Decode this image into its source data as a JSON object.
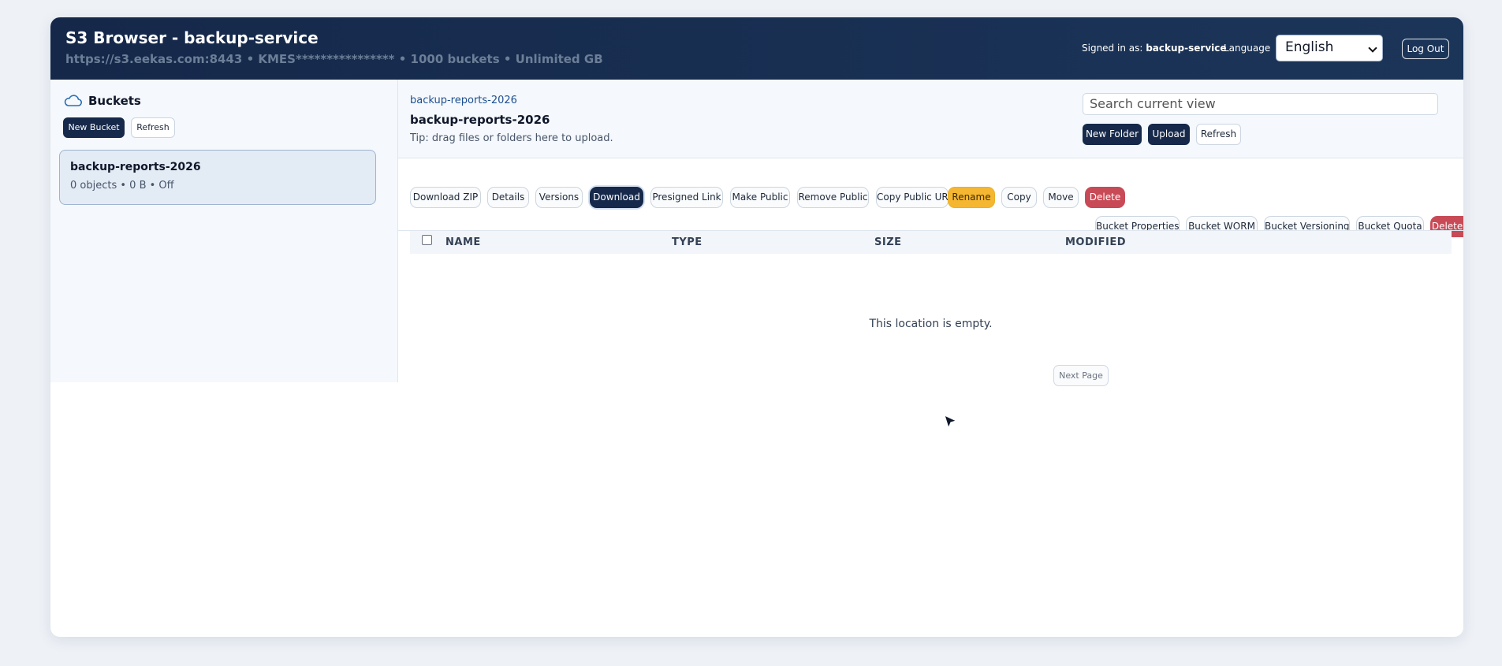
{
  "header": {
    "title": "S3 Browser - backup-service",
    "subtitle": "https://s3.eekas.com:8443 • KMES**************** • 1000 buckets • Unlimited GB",
    "signed_in_label": "Signed in as:",
    "signed_in_user": "backup-service",
    "language_label": "Language",
    "language_value": "English",
    "logout_label": "Log Out"
  },
  "sidebar": {
    "title": "Buckets",
    "new_bucket_label": "New Bucket",
    "refresh_label": "Refresh",
    "buckets": [
      {
        "name": "backup-reports-2026",
        "meta": "0 objects • 0 B • Off"
      }
    ]
  },
  "main": {
    "breadcrumb": "backup-reports-2026",
    "title": "backup-reports-2026",
    "tip": "Tip: drag files or folders here to upload.",
    "search_placeholder": "Search current view",
    "new_folder_label": "New Folder",
    "upload_label": "Upload",
    "refresh_label": "Refresh",
    "actions": {
      "download_zip": "Download ZIP",
      "details": "Details",
      "versions": "Versions",
      "download": "Download",
      "presigned_link": "Presigned Link",
      "make_public": "Make Public",
      "remove_public": "Remove Public",
      "copy_public_url": "Copy Public URL",
      "rename": "Rename",
      "copy": "Copy",
      "move": "Move",
      "delete": "Delete"
    },
    "bucket_actions": {
      "properties": "Bucket Properties",
      "worm": "Bucket WORM",
      "versioning": "Bucket Versioning",
      "quota": "Bucket Quota",
      "delete": "Delete Bucket"
    },
    "table": {
      "columns": [
        "NAME",
        "TYPE",
        "SIZE",
        "MODIFIED"
      ]
    },
    "empty_message": "This location is empty.",
    "next_page_label": "Next Page"
  },
  "colors": {
    "header_bg": "#15284a",
    "primary_button": "#16294a",
    "warning_button": "#f5b731",
    "danger_button": "#c84a56",
    "link": "#1d4f91"
  }
}
